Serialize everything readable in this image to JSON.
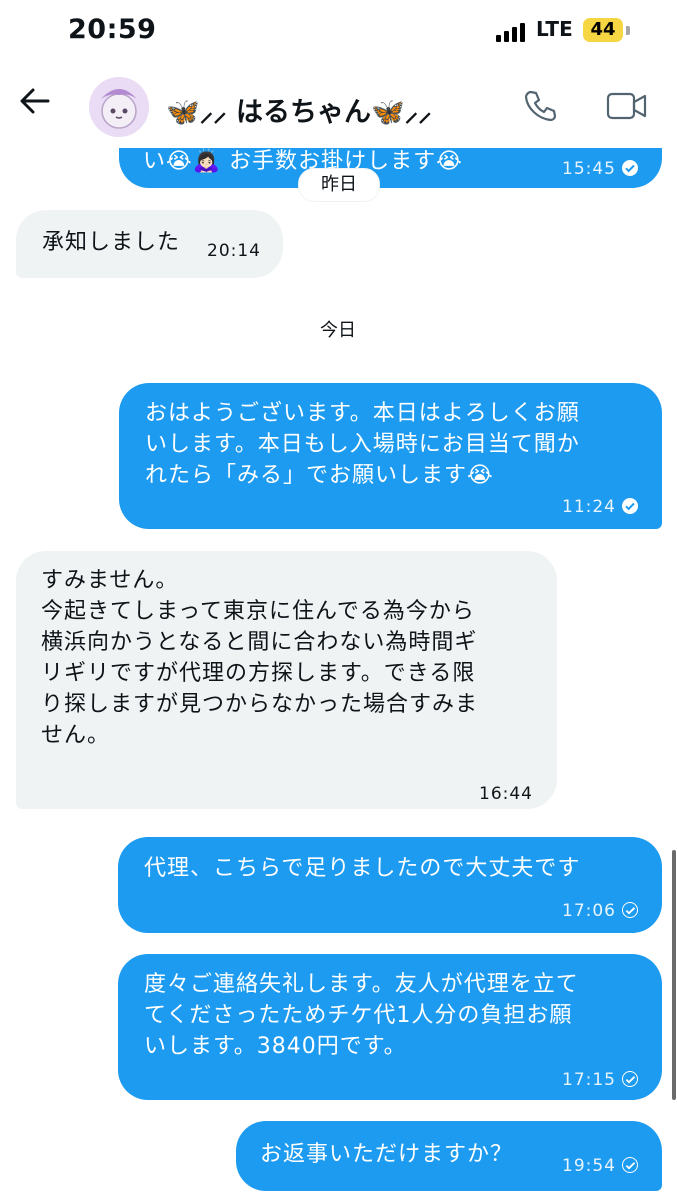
{
  "status_bar": {
    "time": "20:59",
    "network": "LTE",
    "battery": "44"
  },
  "header": {
    "contact_name": "🦋⸝⸝ はるちゃん🦋⸝⸝",
    "icons": [
      "back-arrow-icon",
      "phone-icon",
      "video-icon"
    ]
  },
  "messages": [
    {
      "type": "out",
      "text": "い😭🙇🏻‍♀️ お手数お掛けします😭",
      "time": "15:45"
    },
    {
      "type": "day",
      "text": "昨日"
    },
    {
      "type": "in",
      "text": "承知しました",
      "time": "20:14"
    },
    {
      "type": "day",
      "text": "今日"
    },
    {
      "type": "out",
      "lines": [
        "おはようございます。本日はよろしくお願",
        "いします。本日もし入場時にお目当て聞か",
        "れたら「みる」でお願いします😭"
      ],
      "time": "11:24"
    },
    {
      "type": "in",
      "lines": [
        "すみません。",
        "今起きてしまって東京に住んでる為今から",
        "横浜向かうとなると間に合わない為時間ギ",
        "リギリですが代理の方探します。できる限",
        "り探しますが見つからなかった場合すみま",
        "せん。"
      ],
      "time": "16:44"
    },
    {
      "type": "out",
      "text": "代理、こちらで足りましたので大丈夫です",
      "time": "17:06"
    },
    {
      "type": "out",
      "lines": [
        "度々ご連絡失礼します。友人が代理を立て",
        "てくださったためチケ代1人分の負担お願",
        "いします。3840円です。"
      ],
      "time": "17:15"
    },
    {
      "type": "out",
      "text": "お返事いただけますか？",
      "time": "19:54"
    }
  ],
  "colors": {
    "outgoing": "#1d9bf0",
    "incoming": "#eff3f4",
    "battery": "#f6d743"
  }
}
